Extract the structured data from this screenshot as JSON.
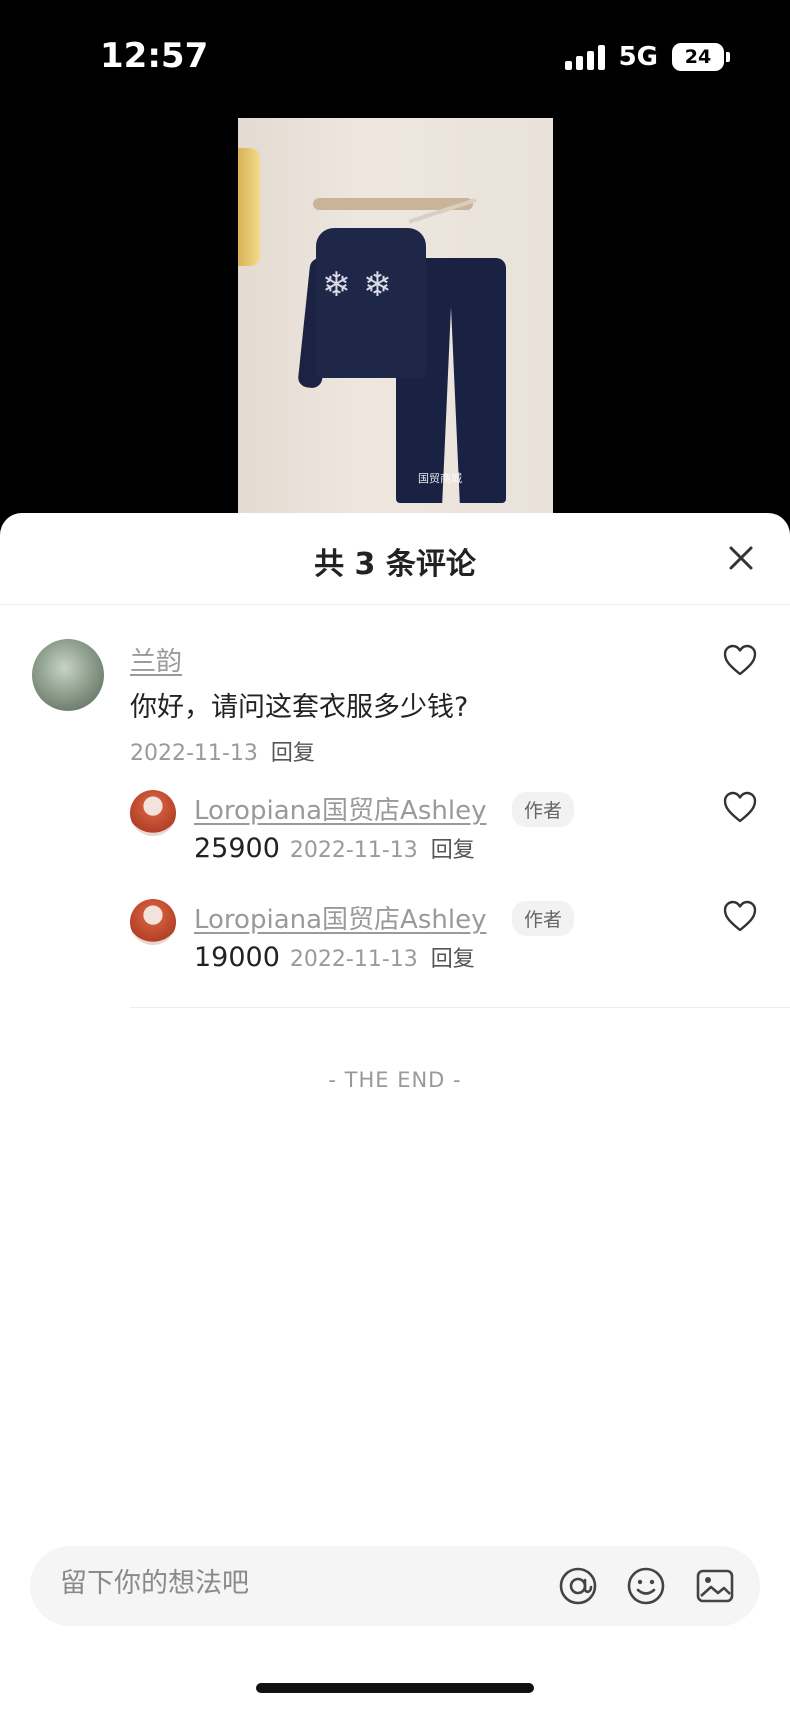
{
  "status_bar": {
    "time": "12:57",
    "network": "5G",
    "battery": "24"
  },
  "photo": {
    "watermark": "国贸商城"
  },
  "comments_panel": {
    "title": "共 3 条评论",
    "comments": [
      {
        "user": "兰韵",
        "text": "你好，请问这套衣服多少钱?",
        "date": "2022-11-13",
        "reply_label": "回复"
      }
    ],
    "replies": [
      {
        "user": "Loropiana国贸店Ashley",
        "badge": "作者",
        "text": "25900",
        "date": "2022-11-13",
        "reply_label": "回复"
      },
      {
        "user": "Loropiana国贸店Ashley",
        "badge": "作者",
        "text": "19000",
        "date": "2022-11-13",
        "reply_label": "回复"
      }
    ],
    "end_text": "- THE END -"
  },
  "input_bar": {
    "placeholder": "留下你的想法吧"
  },
  "icons": {
    "close": "close-icon",
    "like": "heart-icon",
    "mention": "at-icon",
    "emoji": "emoji-icon",
    "image": "image-icon"
  }
}
